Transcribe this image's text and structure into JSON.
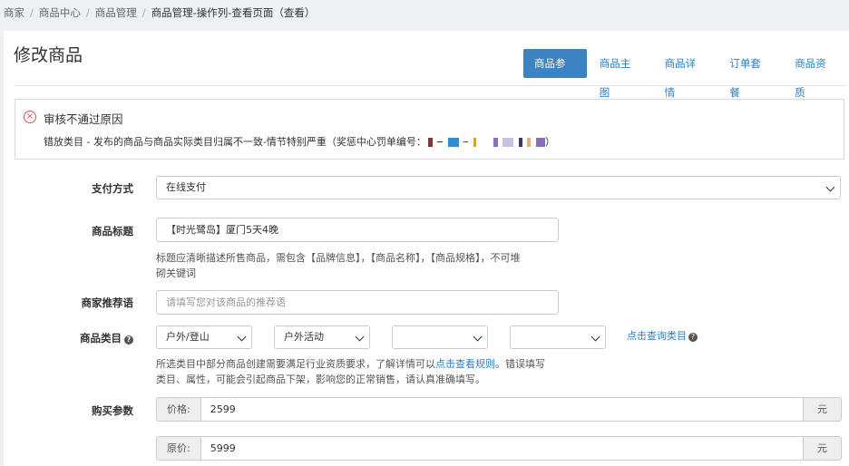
{
  "breadcrumb": [
    "商家",
    "商品中心",
    "商品管理",
    "商品管理-操作列-查看页面（查看）"
  ],
  "page_title": "修改商品",
  "tabs": [
    "商品参数",
    "商品主图",
    "商品详情",
    "订单套餐",
    "商品资质"
  ],
  "alert": {
    "title": "审核不通过原因",
    "message": "错放类目 - 发布的商品与商品实际类目归属不一致-情节特别严重（奖惩中心罚单编号：",
    "message_end": "）"
  },
  "form": {
    "payment": {
      "label": "支付方式",
      "value": "在线支付"
    },
    "product_title": {
      "label": "商品标题",
      "value": "【时光鹭岛】厦门5天4晚",
      "help_line1": "标题应清晰描述所售商品，需包含【品牌信息】，【商品名称】，【商品规格】，不可堆",
      "help_line2": "砌关键词"
    },
    "recommendation": {
      "label": "商家推荐语",
      "placeholder": "请填写您对该商品的推荐语"
    },
    "category": {
      "label": "商品类目",
      "selects": [
        "户外/登山",
        "户外活动",
        "",
        ""
      ],
      "query_link": "点击查询类目",
      "help_pre": "所选类目中部分商品创建需要满足行业资质要求，了解详情可以",
      "help_link": "点击查看规则",
      "help_post": "。错误填写",
      "help_line2": "类目、属性，可能会引起商品下架，影响您的正常销售，请认真准确填写。"
    },
    "purchase": {
      "label": "购买参数",
      "price_label": "价格:",
      "price_value": "2599",
      "original_label": "原价:",
      "original_value": "5999",
      "unit": "元"
    }
  }
}
